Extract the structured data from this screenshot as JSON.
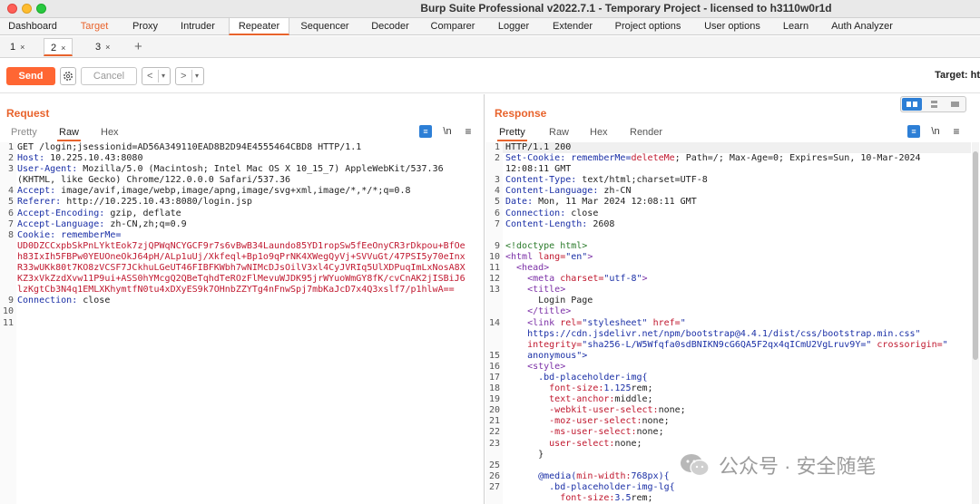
{
  "window": {
    "title": "Burp Suite Professional v2022.7.1 - Temporary Project - licensed to h3110w0r1d"
  },
  "main_tabs": [
    {
      "label": "Dashboard",
      "state": "normal"
    },
    {
      "label": "Target",
      "state": "highlight"
    },
    {
      "label": "Proxy",
      "state": "normal"
    },
    {
      "label": "Intruder",
      "state": "normal"
    },
    {
      "label": "Repeater",
      "state": "active"
    },
    {
      "label": "Sequencer",
      "state": "normal"
    },
    {
      "label": "Decoder",
      "state": "normal"
    },
    {
      "label": "Comparer",
      "state": "normal"
    },
    {
      "label": "Logger",
      "state": "normal"
    },
    {
      "label": "Extender",
      "state": "normal"
    },
    {
      "label": "Project options",
      "state": "normal"
    },
    {
      "label": "User options",
      "state": "normal"
    },
    {
      "label": "Learn",
      "state": "normal"
    },
    {
      "label": "Auth Analyzer",
      "state": "normal"
    }
  ],
  "repeater_tabs": [
    {
      "label": "1",
      "close": "×",
      "active": false
    },
    {
      "label": "2",
      "close": "×",
      "active": true
    },
    {
      "label": "3",
      "close": "×",
      "active": false
    }
  ],
  "repeater_add": "+",
  "toolbar": {
    "send_label": "Send",
    "cancel_label": "Cancel",
    "prev_glyph": "<",
    "next_glyph": ">",
    "dropdown_glyph": "▾",
    "settings_icon": "gear-icon",
    "target_label": "Target: ht"
  },
  "request": {
    "title": "Request",
    "view_tabs": [
      "Pretty",
      "Raw",
      "Hex"
    ],
    "active_view": "Raw",
    "icons": {
      "wrap": "wrap-icon",
      "newline": "\\n",
      "menu": "≡"
    },
    "line_numbers": [
      "1",
      "2",
      "3",
      "",
      "4",
      "5",
      "6",
      "7",
      "8",
      "",
      "",
      "",
      "",
      "",
      "9",
      "10",
      "11"
    ],
    "lines": [
      {
        "parts": [
          {
            "t": "GET /login;jsessionid=AD56A349110EAD8B2D94E4555464CBD8 HTTP/1.1",
            "c": ""
          }
        ]
      },
      {
        "parts": [
          {
            "t": "Host: ",
            "c": "navy"
          },
          {
            "t": "10.225.10.43:8080",
            "c": ""
          }
        ]
      },
      {
        "parts": [
          {
            "t": "User-Agent: ",
            "c": "navy"
          },
          {
            "t": "Mozilla/5.0 (Macintosh; Intel Mac OS X 10_15_7) AppleWebKit/537.36",
            "c": ""
          }
        ]
      },
      {
        "parts": [
          {
            "t": "(KHTML, like Gecko) Chrome/122.0.0.0 Safari/537.36",
            "c": ""
          }
        ]
      },
      {
        "parts": [
          {
            "t": "Accept: ",
            "c": "navy"
          },
          {
            "t": "image/avif,image/webp,image/apng,image/svg+xml,image/*,*/*;q=0.8",
            "c": ""
          }
        ]
      },
      {
        "parts": [
          {
            "t": "Referer: ",
            "c": "navy"
          },
          {
            "t": "http://10.225.10.43:8080/login.jsp",
            "c": ""
          }
        ]
      },
      {
        "parts": [
          {
            "t": "Accept-Encoding: ",
            "c": "navy"
          },
          {
            "t": "gzip, deflate",
            "c": ""
          }
        ]
      },
      {
        "parts": [
          {
            "t": "Accept-Language: ",
            "c": "navy"
          },
          {
            "t": "zh-CN,zh;q=0.9",
            "c": ""
          }
        ]
      },
      {
        "parts": [
          {
            "t": "Cookie: ",
            "c": "navy"
          },
          {
            "t": "rememberMe=",
            "c": "blue"
          }
        ]
      },
      {
        "parts": [
          {
            "t": "UD0DZCCxpbSkPnLYktEok7zjQPWqNCYGCF9r7s6vBwB34Laundo85YD1ropSw5fEeOnyCR3rDkpou+BfOe",
            "c": "red"
          }
        ]
      },
      {
        "parts": [
          {
            "t": "h83IxIh5FBPw0YEUOneOkJ64pH/ALp1uUj/Xkfeql+Bp1o9qPrNK4XWegQyVj+SVVuGt/47PSI5y70eInx",
            "c": "red"
          }
        ]
      },
      {
        "parts": [
          {
            "t": "R33wUKk80t7KO8zVCSF7JCkhuLGeUT46FIBFKWbh7wNIMcDJsOilV3xl4CyJVRIq5UlXDPuqImLxNosA8X",
            "c": "red"
          }
        ]
      },
      {
        "parts": [
          {
            "t": "KZ3xVkZzdXvw11P9ui+ASS0hYMcgQ2QBeTqhdTeROzFlMevuWJDK95jrWYuoWmGY8fK/cvCnAK2jISBiJ6",
            "c": "red"
          }
        ]
      },
      {
        "parts": [
          {
            "t": "lzKgtCb3N4q1EMLXKhymtfN0tu4xDXyES9k7OHnbZZYTg4nFnwSpj7mbKaJcD7x4Q3xslf7/p1hlwA==",
            "c": "red"
          }
        ]
      },
      {
        "parts": [
          {
            "t": "Connection: ",
            "c": "navy"
          },
          {
            "t": "close",
            "c": ""
          }
        ]
      },
      {
        "parts": [
          {
            "t": "",
            "c": ""
          }
        ]
      },
      {
        "parts": [
          {
            "t": "",
            "c": ""
          }
        ]
      }
    ]
  },
  "response": {
    "title": "Response",
    "view_tabs": [
      "Pretty",
      "Raw",
      "Hex",
      "Render"
    ],
    "active_view": "Pretty",
    "icons": {
      "wrap": "wrap-icon",
      "newline": "\\n",
      "menu": "≡"
    },
    "layout_toggle": [
      "split-horizontal-icon",
      "split-vertical-icon",
      "single-pane-icon"
    ],
    "line_numbers": [
      "1",
      "2",
      "",
      "3",
      "4",
      "5",
      "6",
      "7",
      "",
      "9",
      "10",
      "11",
      "12",
      "13",
      "",
      "",
      "14",
      "",
      "",
      "15",
      "16",
      "17",
      "18",
      "19",
      "20",
      "21",
      "22",
      "23",
      "",
      "25",
      "26",
      "27"
    ],
    "lines": [
      {
        "parts": [
          {
            "t": "HTTP/1.1 200",
            "c": ""
          }
        ]
      },
      {
        "parts": [
          {
            "t": "Set-Cookie: ",
            "c": "navy"
          },
          {
            "t": "rememberMe=",
            "c": "blue"
          },
          {
            "t": "deleteMe",
            "c": "red"
          },
          {
            "t": "; Path=/; Max-Age=0; Expires=Sun, 10-Mar-2024",
            "c": ""
          }
        ]
      },
      {
        "parts": [
          {
            "t": "12:08:11 GMT",
            "c": ""
          }
        ]
      },
      {
        "parts": [
          {
            "t": "Content-Type: ",
            "c": "navy"
          },
          {
            "t": "text/html;charset=UTF-8",
            "c": ""
          }
        ]
      },
      {
        "parts": [
          {
            "t": "Content-Language: ",
            "c": "navy"
          },
          {
            "t": "zh-CN",
            "c": ""
          }
        ]
      },
      {
        "parts": [
          {
            "t": "Date: ",
            "c": "navy"
          },
          {
            "t": "Mon, 11 Mar 2024 12:08:11 GMT",
            "c": ""
          }
        ]
      },
      {
        "parts": [
          {
            "t": "Connection: ",
            "c": "navy"
          },
          {
            "t": "close",
            "c": ""
          }
        ]
      },
      {
        "parts": [
          {
            "t": "Content-Length: ",
            "c": "navy"
          },
          {
            "t": "2608",
            "c": ""
          }
        ]
      },
      {
        "parts": [
          {
            "t": "",
            "c": ""
          }
        ]
      },
      {
        "parts": [
          {
            "t": "<!doctype html>",
            "c": "green"
          }
        ]
      },
      {
        "parts": [
          {
            "t": "<html ",
            "c": "purple"
          },
          {
            "t": "lang=",
            "c": "red"
          },
          {
            "t": "\"en\"",
            "c": "blue"
          },
          {
            "t": ">",
            "c": "purple"
          }
        ]
      },
      {
        "parts": [
          {
            "t": "  <head>",
            "c": "purple"
          }
        ]
      },
      {
        "parts": [
          {
            "t": "    <meta ",
            "c": "purple"
          },
          {
            "t": "charset=",
            "c": "red"
          },
          {
            "t": "\"utf-8\"",
            "c": "blue"
          },
          {
            "t": ">",
            "c": "purple"
          }
        ]
      },
      {
        "parts": [
          {
            "t": "    <title>",
            "c": "purple"
          }
        ]
      },
      {
        "parts": [
          {
            "t": "      Login Page",
            "c": ""
          }
        ]
      },
      {
        "parts": [
          {
            "t": "    </title>",
            "c": "purple"
          }
        ]
      },
      {
        "parts": [
          {
            "t": "    <link ",
            "c": "purple"
          },
          {
            "t": "rel=",
            "c": "red"
          },
          {
            "t": "\"stylesheet\" ",
            "c": "blue"
          },
          {
            "t": "href=",
            "c": "red"
          },
          {
            "t": "\"",
            "c": "blue"
          }
        ]
      },
      {
        "parts": [
          {
            "t": "    https://cdn.jsdelivr.net/npm/bootstrap@4.4.1/dist/css/bootstrap.min.css\"",
            "c": "blue"
          }
        ]
      },
      {
        "parts": [
          {
            "t": "    integrity=",
            "c": "red"
          },
          {
            "t": "\"sha256-L/W5Wfqfa0sdBNIKN9cG6QA5F2qx4qICmU2VgLruv9Y=\" ",
            "c": "blue"
          },
          {
            "t": "crossorigin=",
            "c": "red"
          },
          {
            "t": "\"",
            "c": "blue"
          }
        ]
      },
      {
        "parts": [
          {
            "t": "    anonymous\">",
            "c": "blue"
          }
        ]
      },
      {
        "parts": [
          {
            "t": "    <style>",
            "c": "purple"
          }
        ]
      },
      {
        "parts": [
          {
            "t": "      .bd-placeholder-img{",
            "c": "navy"
          }
        ]
      },
      {
        "parts": [
          {
            "t": "        font-size:",
            "c": "red"
          },
          {
            "t": "1.125",
            "c": "blue"
          },
          {
            "t": "rem;",
            "c": ""
          }
        ]
      },
      {
        "parts": [
          {
            "t": "        text-anchor:",
            "c": "red"
          },
          {
            "t": "middle;",
            "c": ""
          }
        ]
      },
      {
        "parts": [
          {
            "t": "        -webkit-user-select:",
            "c": "red"
          },
          {
            "t": "none;",
            "c": ""
          }
        ]
      },
      {
        "parts": [
          {
            "t": "        -moz-user-select:",
            "c": "red"
          },
          {
            "t": "none;",
            "c": ""
          }
        ]
      },
      {
        "parts": [
          {
            "t": "        -ms-user-select:",
            "c": "red"
          },
          {
            "t": "none;",
            "c": ""
          }
        ]
      },
      {
        "parts": [
          {
            "t": "        user-select:",
            "c": "red"
          },
          {
            "t": "none;",
            "c": ""
          }
        ]
      },
      {
        "parts": [
          {
            "t": "      }",
            "c": ""
          }
        ]
      },
      {
        "parts": [
          {
            "t": "",
            "c": ""
          }
        ]
      },
      {
        "parts": [
          {
            "t": "      @media(",
            "c": "navy"
          },
          {
            "t": "min-width:",
            "c": "red"
          },
          {
            "t": "768px){",
            "c": "navy"
          }
        ]
      },
      {
        "parts": [
          {
            "t": "        .bd-placeholder-img-lg{",
            "c": "navy"
          }
        ]
      },
      {
        "parts": [
          {
            "t": "          font-size:",
            "c": "red"
          },
          {
            "t": "3.5",
            "c": "blue"
          },
          {
            "t": "rem;",
            "c": ""
          }
        ]
      }
    ]
  },
  "watermark": {
    "text": "公众号 · 安全随笔",
    "icon": "wechat-icon"
  },
  "colors": {
    "accent": "#e8632c",
    "send_button": "#ff6633",
    "wrap_icon": "#2d7fd6"
  }
}
